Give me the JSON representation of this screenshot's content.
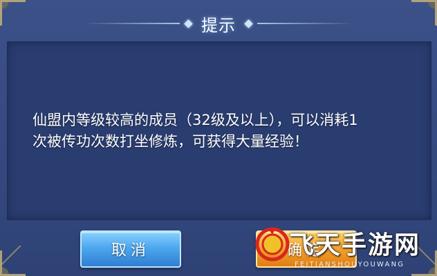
{
  "dialog": {
    "title": "提示",
    "message_line1": "仙盟内等级较高的成员（32级及以上），可以消耗1",
    "message_line2": "次被传功次数打坐修炼，可获得大量经验！"
  },
  "buttons": {
    "cancel_label": "取消",
    "confirm_label": "确定"
  },
  "watermark": {
    "text": "飞天手游网",
    "subtext": "FEITIANSHOUYOUWANG"
  },
  "colors": {
    "panel_bg": "#2a3d70",
    "dialog_bg": "#34497f",
    "cancel_blue": "#4ea8ee",
    "confirm_orange": "#f3a12c",
    "watermark_red": "#d6281e"
  }
}
